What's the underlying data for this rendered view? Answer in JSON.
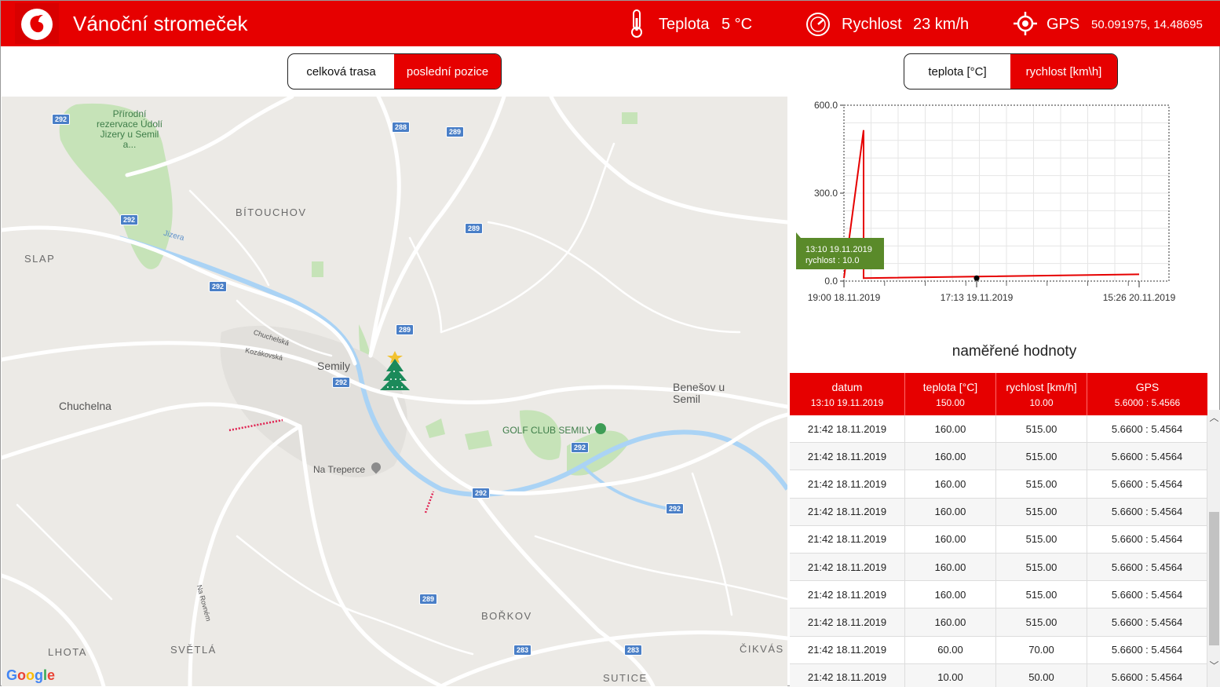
{
  "header": {
    "title": "Vánoční stromeček",
    "temp_label": "Teplota",
    "temp_value": "5 °C",
    "speed_label": "Rychlost",
    "speed_value": "23 km/h",
    "gps_label": "GPS",
    "gps_value": "50.091975, 14.48695"
  },
  "map_toggle": {
    "options": [
      "celková trasa",
      "poslední pozice"
    ],
    "active": "poslední pozice"
  },
  "chart_toggle": {
    "options": [
      "teplota [°C]",
      "rychlost [km\\h]"
    ],
    "active": "rychlost [km\\h]"
  },
  "map": {
    "places": [
      "BÍTOUCHOV",
      "SLAP",
      "Chuchelna",
      "Semily",
      "Benešov u Semil",
      "GOLF CLUB SEMILY",
      "Na Treperce",
      "BOŘKOV",
      "LHOTA",
      "SVĚTLÁ",
      "ČIKVÁS",
      "SUTICE"
    ],
    "park": "Přírodní rezervace Údolí Jizery u Semil a...",
    "streets": [
      "Jizera",
      "Chuchelská",
      "Kozákovská",
      "Na Rovném"
    ],
    "road_numbers": [
      "292",
      "288",
      "289",
      "283"
    ],
    "attribution": "Google",
    "marker_icon": "christmas-tree-icon"
  },
  "chart_data": {
    "type": "line",
    "series": [
      {
        "points": [
          {
            "x": "19:00 18.11.2019",
            "y": 10
          },
          {
            "x": "21:42 18.11.2019",
            "y": 515
          },
          {
            "x": "13:10 19.11.2019",
            "y": 10
          },
          {
            "x": "15:26 20.11.2019",
            "y": 23
          }
        ]
      }
    ],
    "x_ticks": [
      "19:00 18.11.2019",
      "17:13 19.11.2019",
      "15:26 20.11.2019"
    ],
    "y_ticks": [
      "0.0",
      "300.0",
      "600.0"
    ],
    "ylim": [
      0,
      600
    ],
    "grid": true,
    "tooltip": {
      "line1": "13:10 19.11.2019",
      "line2": "rychlost : 10.0"
    },
    "color": "#e60000"
  },
  "table": {
    "title": "naměřené hodnoty",
    "columns": [
      "datum",
      "teplota [°C]",
      "rychlost [km/h]",
      "GPS"
    ],
    "latest": [
      "13:10 19.11.2019",
      "150.00",
      "10.00",
      "5.6000 : 5.4566"
    ],
    "rows": [
      [
        "21:42 18.11.2019",
        "160.00",
        "515.00",
        "5.6600 : 5.4564"
      ],
      [
        "21:42 18.11.2019",
        "160.00",
        "515.00",
        "5.6600 : 5.4564"
      ],
      [
        "21:42 18.11.2019",
        "160.00",
        "515.00",
        "5.6600 : 5.4564"
      ],
      [
        "21:42 18.11.2019",
        "160.00",
        "515.00",
        "5.6600 : 5.4564"
      ],
      [
        "21:42 18.11.2019",
        "160.00",
        "515.00",
        "5.6600 : 5.4564"
      ],
      [
        "21:42 18.11.2019",
        "160.00",
        "515.00",
        "5.6600 : 5.4564"
      ],
      [
        "21:42 18.11.2019",
        "160.00",
        "515.00",
        "5.6600 : 5.4564"
      ],
      [
        "21:42 18.11.2019",
        "160.00",
        "515.00",
        "5.6600 : 5.4564"
      ],
      [
        "21:42 18.11.2019",
        "60.00",
        "70.00",
        "5.6600 : 5.4564"
      ],
      [
        "21:42 18.11.2019",
        "10.00",
        "50.00",
        "5.6600 : 5.4564"
      ]
    ]
  }
}
